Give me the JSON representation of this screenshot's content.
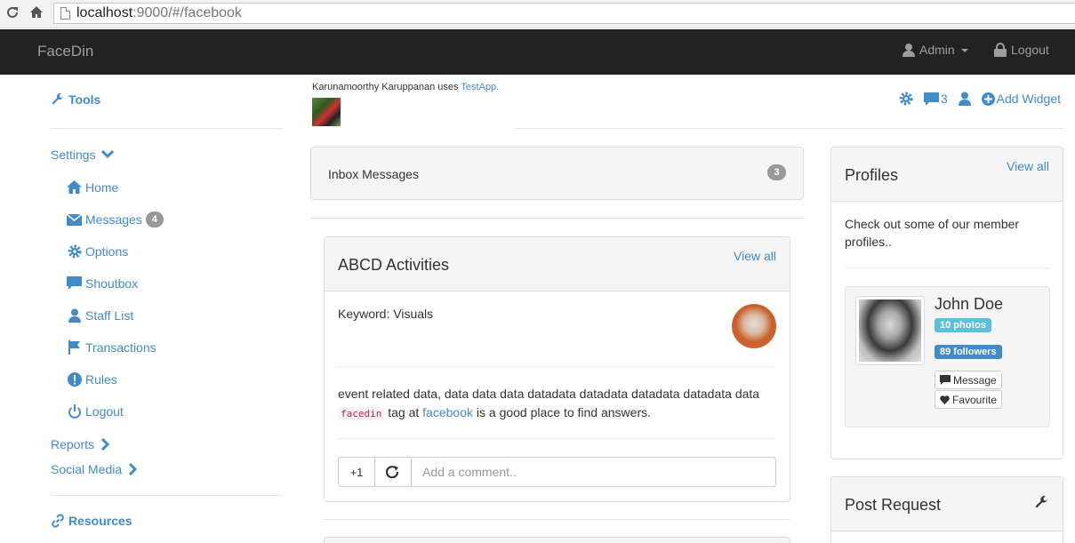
{
  "browser": {
    "url_host": "localhost",
    "url_rest": ":9000/#/facebook"
  },
  "navbar": {
    "brand": "FaceDin",
    "admin_label": "Admin",
    "logout_label": "Logout"
  },
  "sidebar": {
    "tools_label": "Tools",
    "settings_label": "Settings",
    "items": [
      {
        "label": "Home",
        "icon": "home-icon"
      },
      {
        "label": "Messages",
        "icon": "envelope-icon",
        "badge": "4"
      },
      {
        "label": "Options",
        "icon": "cog-icon"
      },
      {
        "label": "Shoutbox",
        "icon": "comment-icon"
      },
      {
        "label": "Staff List",
        "icon": "user-icon"
      },
      {
        "label": "Transactions",
        "icon": "flag-icon"
      },
      {
        "label": "Rules",
        "icon": "exclamation-icon"
      },
      {
        "label": "Logout",
        "icon": "power-icon"
      }
    ],
    "reports_label": "Reports",
    "social_label": "Social Media",
    "resources_label": "Resources"
  },
  "topbar": {
    "user_name": "Karunamoorthy Karuppanan",
    "uses_text": "uses",
    "app_name": "TestApp.",
    "comment_count": "3",
    "add_widget_label": "Add Widget"
  },
  "inbox": {
    "label": "Inbox Messages",
    "count": "3"
  },
  "activities": {
    "title": "ABCD Activities",
    "view_all": "View all",
    "keyword": "Keyword: Visuals",
    "text_before": "event related data, data data data datadata datadata datadata datadata data",
    "code": "facedin",
    "text_middle": "tag at",
    "link": "facebook",
    "text_after": "is a good place to find answers.",
    "plus_one": "+1",
    "comment_placeholder": "Add a comment.."
  },
  "profiles": {
    "title": "Profiles",
    "view_all": "View all",
    "intro": "Check out some of our member profiles..",
    "name": "John Doe",
    "photos": "10 photos",
    "followers": "89 followers",
    "message_label": "Message",
    "favourite_label": "Favourite"
  },
  "post_request": {
    "title": "Post Request"
  },
  "colors": {
    "link": "#428bca",
    "navbar": "#222222",
    "badge": "#999999",
    "info": "#5bc0de"
  }
}
